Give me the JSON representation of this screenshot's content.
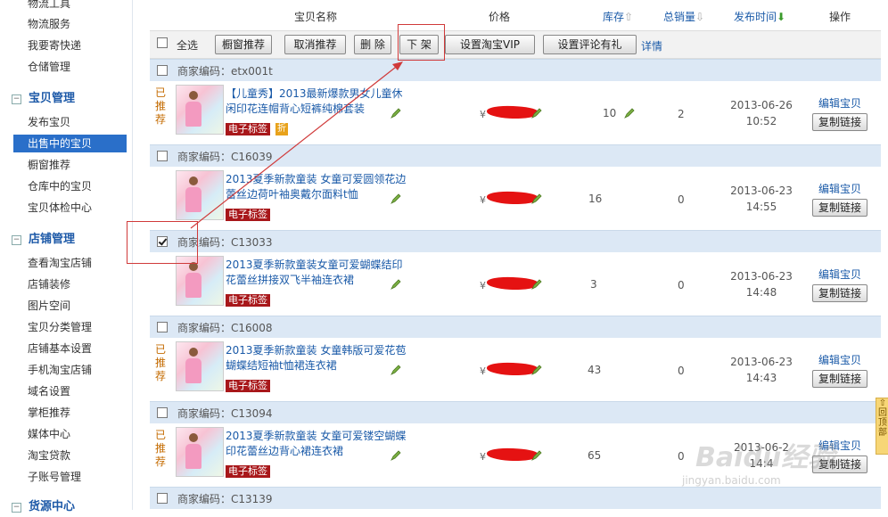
{
  "sidebar": {
    "top_items": [
      "物流工具",
      "物流服务",
      "我要寄快递",
      "仓储管理"
    ],
    "sections": [
      {
        "title": "宝贝管理",
        "items": [
          "发布宝贝",
          "出售中的宝贝",
          "橱窗推荐",
          "仓库中的宝贝",
          "宝贝体检中心"
        ]
      },
      {
        "title": "店铺管理",
        "items": [
          "查看淘宝店铺",
          "店铺装修",
          "图片空间",
          "宝贝分类管理",
          "店铺基本设置",
          "手机淘宝店铺",
          "域名设置",
          "掌柜推荐",
          "媒体中心",
          "淘宝贷款",
          "子账号管理"
        ]
      },
      {
        "title": "货源中心",
        "items": []
      }
    ],
    "active_item": "出售中的宝贝"
  },
  "table_header": {
    "name": "宝贝名称",
    "price": "价格",
    "stock": "库存",
    "sales": "总销量",
    "publish_time": "发布时间",
    "ops": "操作"
  },
  "toolbar": {
    "select_all": "全选",
    "showcase": "橱窗推荐",
    "cancel_showcase": "取消推荐",
    "delete": "删 除",
    "delist": "下 架",
    "set_vip": "设置淘宝VIP",
    "set_review": "设置评论有礼",
    "details": "详情"
  },
  "groups": [
    {
      "code": "商家编码：etx001t",
      "checked": false,
      "item": {
        "recommended": "已推荐",
        "title": "【儿童秀】2013最新爆款男女儿童休闲印花连帽背心短裤纯棉套装",
        "tag": "电子标签",
        "tag2": "折",
        "price_symbol": "¥",
        "stock": "10",
        "sales": "2",
        "date": "2013-06-26",
        "time": "10:52"
      }
    },
    {
      "code": "商家编码：C16039",
      "checked": false,
      "item": {
        "recommended": "",
        "title": "2013夏季新款童装 女童可爱圆领花边蕾丝边荷叶袖奥戴尔面料t恤",
        "tag": "电子标签",
        "tag2": "",
        "price_symbol": "¥",
        "stock": "16",
        "sales": "0",
        "date": "2013-06-23",
        "time": "14:55"
      }
    },
    {
      "code": "商家编码：C13033",
      "checked": true,
      "item": {
        "recommended": "",
        "title": "2013夏季新款童装女童可爱蝴蝶结印花蕾丝拼接双飞半袖连衣裙",
        "tag": "电子标签",
        "tag2": "",
        "price_symbol": "¥",
        "stock": "3",
        "sales": "0",
        "date": "2013-06-23",
        "time": "14:48"
      }
    },
    {
      "code": "商家编码：C16008",
      "checked": false,
      "item": {
        "recommended": "已推荐",
        "title": "2013夏季新款童装 女童韩版可爱花苞蝴蝶结短袖t恤裙连衣裙",
        "tag": "电子标签",
        "tag2": "",
        "price_symbol": "¥",
        "stock": "43",
        "sales": "0",
        "date": "2013-06-23",
        "time": "14:43"
      }
    },
    {
      "code": "商家编码：C13094",
      "checked": false,
      "item": {
        "recommended": "已推荐",
        "title": "2013夏季新款童装 女童可爱镂空蝴蝶印花蕾丝边背心裙连衣裙",
        "tag": "电子标签",
        "tag2": "",
        "price_symbol": "¥",
        "stock": "65",
        "sales": "0",
        "date": "2013-06-2",
        "time": "14:4"
      }
    },
    {
      "code": "商家编码：C13139",
      "checked": false,
      "item": null
    }
  ],
  "row_actions": {
    "edit": "编辑宝贝",
    "copy": "复制链接"
  },
  "back_top": "回顶部",
  "watermark": "Baidu经验",
  "watermark_url": "jingyan.baidu.com",
  "colors": {
    "accent": "#2a6fc9",
    "link": "#1a5aa8",
    "group_bg": "#dce8f5",
    "highlight": "#d03a3a",
    "tag": "#a8171a"
  }
}
